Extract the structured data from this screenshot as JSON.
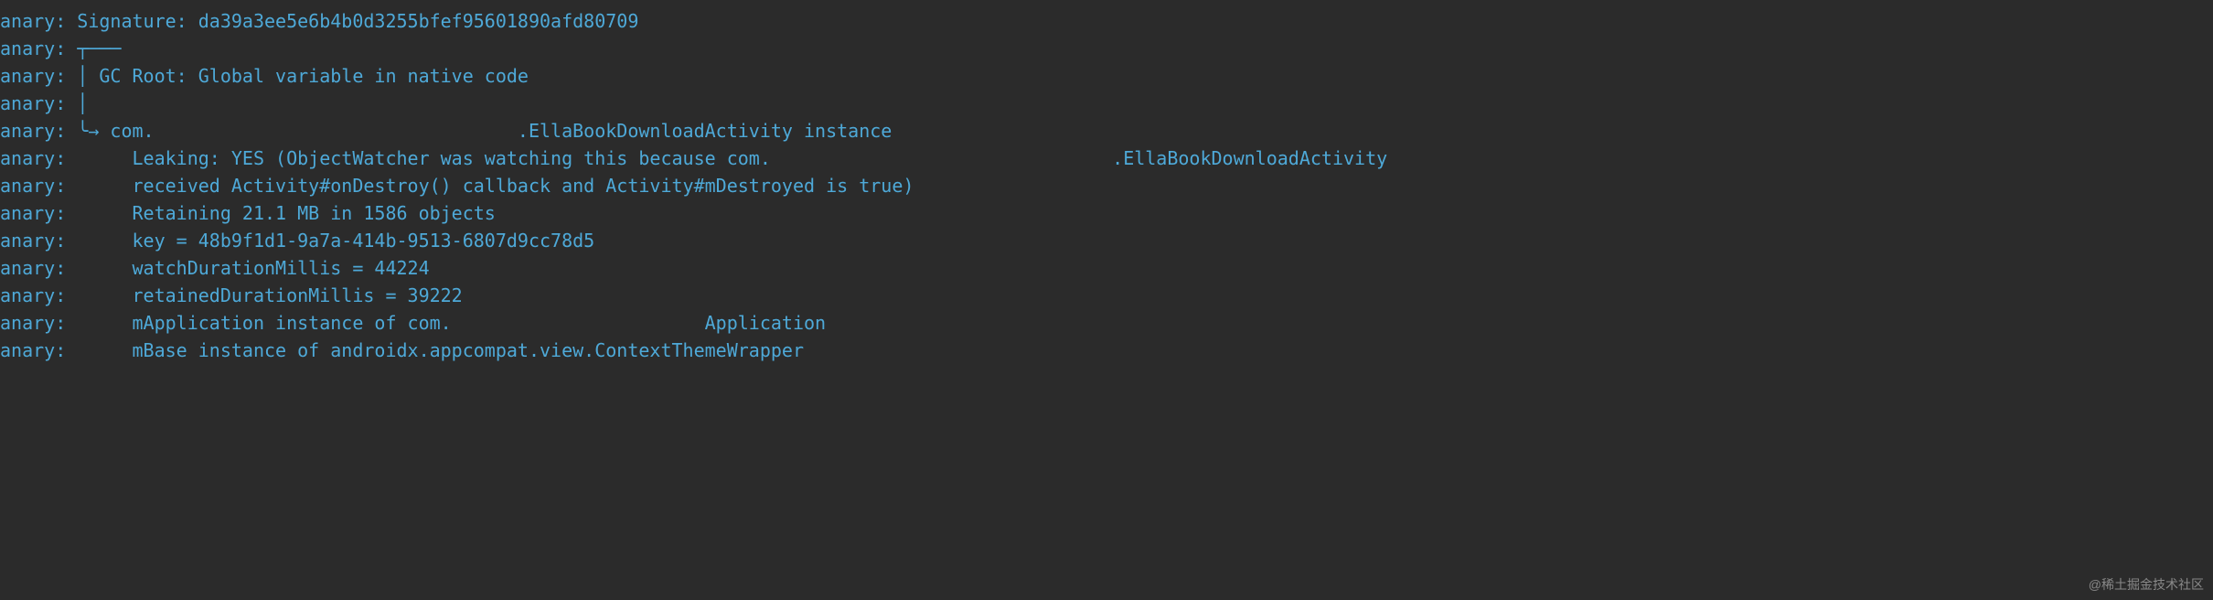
{
  "log": {
    "tag": "anary:",
    "lines": [
      {
        "prefix": " ",
        "text": "Signature: da39a3ee5e6b4b0d3255bfef95601890afd80709"
      },
      {
        "prefix": " ",
        "text": "┬───"
      },
      {
        "prefix": " ",
        "text": "│ GC Root: Global variable in native code"
      },
      {
        "prefix": " ",
        "text": "│"
      },
      {
        "prefix": " ",
        "text": "╰→ com.                                 .EllaBookDownloadActivity instance"
      },
      {
        "prefix": " ",
        "text": "     Leaking: YES (ObjectWatcher was watching this because com.                               .EllaBookDownloadActivity"
      },
      {
        "prefix": " ",
        "text": "     received Activity#onDestroy() callback and Activity#mDestroyed is true)"
      },
      {
        "prefix": " ",
        "text": "     Retaining 21.1 MB in 1586 objects"
      },
      {
        "prefix": " ",
        "text": "     key = 48b9f1d1-9a7a-414b-9513-6807d9cc78d5"
      },
      {
        "prefix": " ",
        "text": "     watchDurationMillis = 44224"
      },
      {
        "prefix": " ",
        "text": "     retainedDurationMillis = 39222"
      },
      {
        "prefix": " ",
        "text": "     mApplication instance of com.                       Application"
      },
      {
        "prefix": " ",
        "text": "     mBase instance of androidx.appcompat.view.ContextThemeWrapper"
      }
    ]
  },
  "watermark": "@稀土掘金技术社区"
}
